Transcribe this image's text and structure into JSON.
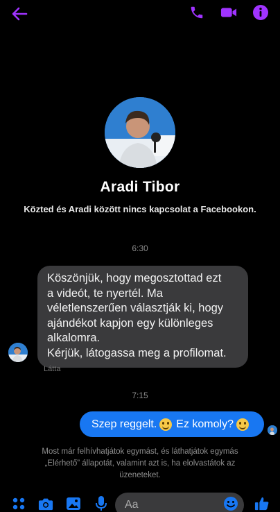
{
  "header": {
    "back_icon": "arrow-left-icon",
    "actions": [
      "phone-icon",
      "video-camera-icon",
      "info-icon"
    ],
    "accent_color": "#a033ff"
  },
  "profile": {
    "name": "Aradi Tibor",
    "subtitle": "Közted és Aradi között nincs kapcsolat a Facebookon."
  },
  "conversation": {
    "time_1": "6:30",
    "incoming_lines": [
      "Köszönjük, hogy megosztottad ezt",
      "a videót, te nyertél. Ma",
      "véletlenszerűen választják ki, hogy",
      "ajándékot kapjon egy különleges",
      "alkalomra.",
      "Kérjük, látogassa meg a profilomat."
    ],
    "seen_label": "Látta",
    "time_2": "7:15",
    "outgoing_part1": "Szep reggelt.",
    "outgoing_part2": "Ez komoly?",
    "outgoing_color": "#1877f2",
    "info_text": "Most már felhívhatjátok egymást, és láthatjátok egymás „Elérhető” állapotát, valamint azt is, ha elolvastátok az üzeneteket."
  },
  "composer": {
    "placeholder": "Aa",
    "icons": [
      "apps-icon",
      "camera-icon",
      "image-icon",
      "microphone-icon",
      "emoji-icon",
      "thumbs-up-icon"
    ]
  }
}
